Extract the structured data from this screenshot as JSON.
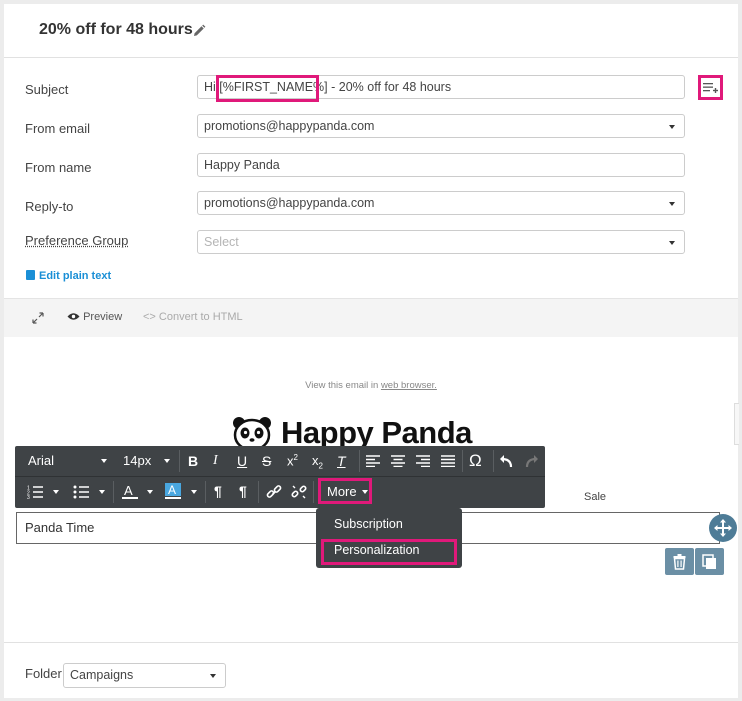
{
  "header": {
    "title": "20% off for 48 hours"
  },
  "form": {
    "subject_label": "Subject",
    "subject_prefix": "Hi ",
    "subject_token": "[%FIRST_NAME%]",
    "subject_suffix": " - 20% off for 48 hours",
    "from_email_label": "From email",
    "from_email_value": "promotions@happypanda.com",
    "from_name_label": "From name",
    "from_name_value": "Happy Panda",
    "reply_to_label": "Reply-to",
    "reply_to_value": "promotions@happypanda.com",
    "preference_group_label": "Preference Group",
    "preference_group_placeholder": "Select",
    "edit_plain_text": "Edit plain text"
  },
  "editor_tools": {
    "preview": "Preview",
    "convert": "Convert to HTML"
  },
  "email": {
    "view_prefix": "View this email in ",
    "view_link": "web browser.",
    "brand": "Happy Panda",
    "sale_label": "Sale",
    "block_text": "Panda Time"
  },
  "toolbar": {
    "font": "Arial",
    "size": "14px",
    "more": "More"
  },
  "more_menu": {
    "items": [
      "Subscription",
      "Personalization"
    ]
  },
  "footer": {
    "folder_label": "Folder",
    "folder_value": "Campaigns"
  },
  "colors": {
    "highlight": "#e0197a",
    "link": "#1a8fd6",
    "toolbar_bg": "#3f4346"
  }
}
